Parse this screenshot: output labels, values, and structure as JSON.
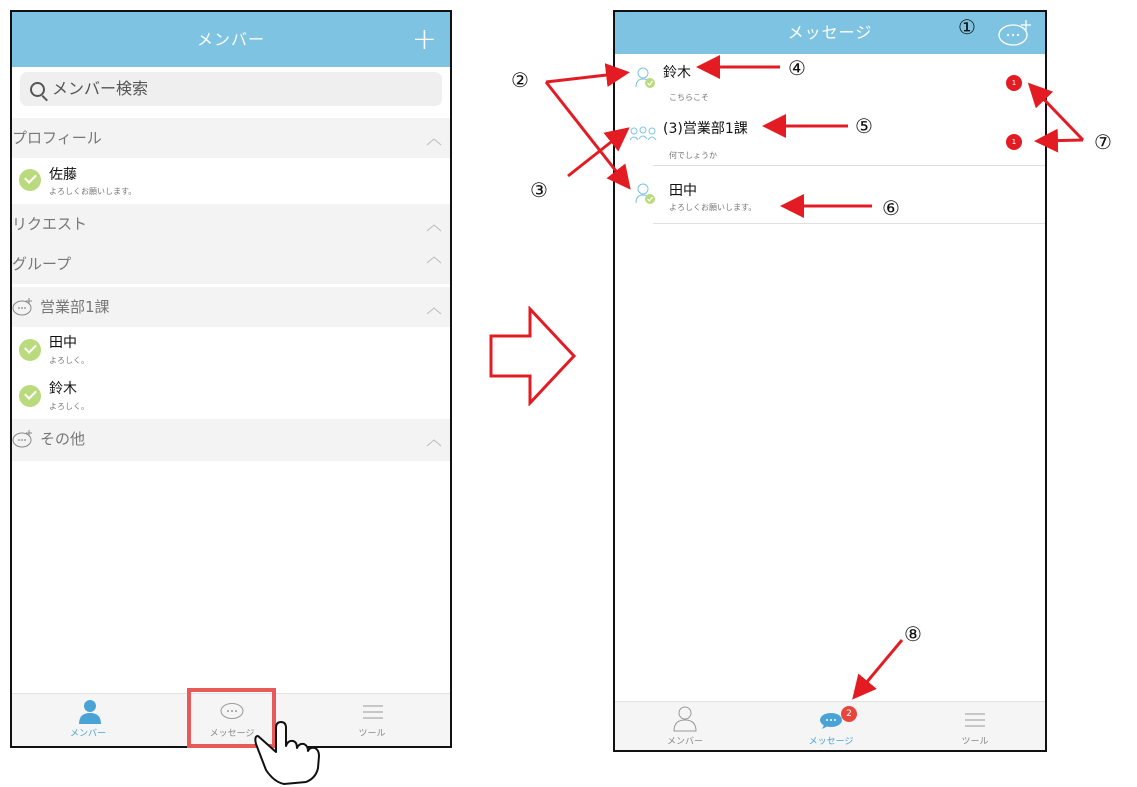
{
  "left_screen": {
    "header": {
      "title": "メンバー",
      "add_button": "+"
    },
    "search": {
      "placeholder": "メンバー検索"
    },
    "sections": {
      "profile": "プロフィール",
      "request": "リクエスト",
      "group": "グループ",
      "eigyo": "営業部1課",
      "other": "その他"
    },
    "profile_row": {
      "name": "佐藤",
      "status": "よろしくお願いします。"
    },
    "eigyo_members": [
      {
        "name": "田中",
        "status": "よろしく。"
      },
      {
        "name": "鈴木",
        "status": "よろしく。"
      }
    ],
    "tabs": {
      "member": "メンバー",
      "message": "メッセージ",
      "tool": "ツール"
    }
  },
  "right_screen": {
    "header": {
      "title": "メッセージ"
    },
    "messages": [
      {
        "name": "鈴木",
        "preview": "こちらこそ",
        "unread": "1"
      },
      {
        "name": "(3)営業部1課",
        "preview": "何でしょうか",
        "unread": "1"
      },
      {
        "name": "田中",
        "preview": "よろしくお願いします。"
      }
    ],
    "tabs": {
      "member": "メンバー",
      "message": "メッセージ",
      "message_badge": "2",
      "tool": "ツール"
    }
  },
  "callouts": [
    "①",
    "②",
    "③",
    "④",
    "⑤",
    "⑥",
    "⑦",
    "⑧"
  ],
  "colors": {
    "header": "#7ec4e2",
    "check": "#b9db7d",
    "badge": "#e31c23",
    "arrow": "#e31c23",
    "highlight": "#e85a5a"
  }
}
